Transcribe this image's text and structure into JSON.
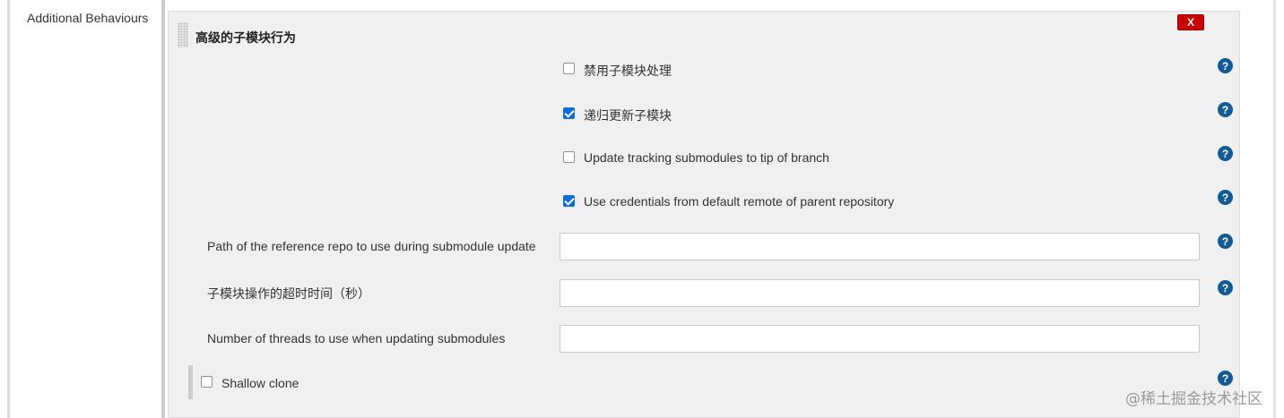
{
  "section": {
    "label": "Additional Behaviours"
  },
  "panel": {
    "title": "高级的子模块行为",
    "delete_label": "X",
    "checkboxes": [
      {
        "label": "禁用子模块处理",
        "checked": false
      },
      {
        "label": "递归更新子模块",
        "checked": true
      },
      {
        "label": "Update tracking submodules to tip of branch",
        "checked": false
      },
      {
        "label": "Use credentials from default remote of parent repository",
        "checked": true
      }
    ],
    "fields": [
      {
        "label": "Path of the reference repo to use during submodule update",
        "value": ""
      },
      {
        "label": "子模块操作的超时时间（秒）",
        "value": ""
      },
      {
        "label": "Number of threads to use when updating submodules",
        "value": ""
      }
    ],
    "shallow_clone": {
      "label": "Shallow clone",
      "checked": false
    },
    "help_glyph": "?"
  },
  "watermark": "@稀土掘金技术社区",
  "colors": {
    "delete": "#cc0000",
    "help": "#135b96",
    "checkbox_checked": "#0a6fd6",
    "panel_bg": "#f0f0f0"
  },
  "icons": [
    "drag-handle-icon",
    "help-icon",
    "checkbox-icon"
  ]
}
